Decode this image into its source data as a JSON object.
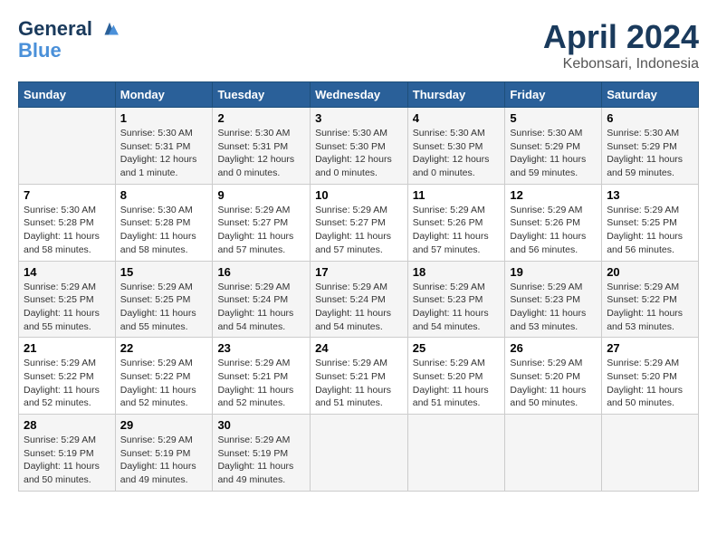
{
  "header": {
    "logo_line1": "General",
    "logo_line2": "Blue",
    "title": "April 2024",
    "subtitle": "Kebonsari, Indonesia"
  },
  "days_of_week": [
    "Sunday",
    "Monday",
    "Tuesday",
    "Wednesday",
    "Thursday",
    "Friday",
    "Saturday"
  ],
  "weeks": [
    [
      {
        "day": "",
        "info": ""
      },
      {
        "day": "1",
        "info": "Sunrise: 5:30 AM\nSunset: 5:31 PM\nDaylight: 12 hours\nand 1 minute."
      },
      {
        "day": "2",
        "info": "Sunrise: 5:30 AM\nSunset: 5:31 PM\nDaylight: 12 hours\nand 0 minutes."
      },
      {
        "day": "3",
        "info": "Sunrise: 5:30 AM\nSunset: 5:30 PM\nDaylight: 12 hours\nand 0 minutes."
      },
      {
        "day": "4",
        "info": "Sunrise: 5:30 AM\nSunset: 5:30 PM\nDaylight: 12 hours\nand 0 minutes."
      },
      {
        "day": "5",
        "info": "Sunrise: 5:30 AM\nSunset: 5:29 PM\nDaylight: 11 hours\nand 59 minutes."
      },
      {
        "day": "6",
        "info": "Sunrise: 5:30 AM\nSunset: 5:29 PM\nDaylight: 11 hours\nand 59 minutes."
      }
    ],
    [
      {
        "day": "7",
        "info": "Sunrise: 5:30 AM\nSunset: 5:28 PM\nDaylight: 11 hours\nand 58 minutes."
      },
      {
        "day": "8",
        "info": "Sunrise: 5:30 AM\nSunset: 5:28 PM\nDaylight: 11 hours\nand 58 minutes."
      },
      {
        "day": "9",
        "info": "Sunrise: 5:29 AM\nSunset: 5:27 PM\nDaylight: 11 hours\nand 57 minutes."
      },
      {
        "day": "10",
        "info": "Sunrise: 5:29 AM\nSunset: 5:27 PM\nDaylight: 11 hours\nand 57 minutes."
      },
      {
        "day": "11",
        "info": "Sunrise: 5:29 AM\nSunset: 5:26 PM\nDaylight: 11 hours\nand 57 minutes."
      },
      {
        "day": "12",
        "info": "Sunrise: 5:29 AM\nSunset: 5:26 PM\nDaylight: 11 hours\nand 56 minutes."
      },
      {
        "day": "13",
        "info": "Sunrise: 5:29 AM\nSunset: 5:25 PM\nDaylight: 11 hours\nand 56 minutes."
      }
    ],
    [
      {
        "day": "14",
        "info": "Sunrise: 5:29 AM\nSunset: 5:25 PM\nDaylight: 11 hours\nand 55 minutes."
      },
      {
        "day": "15",
        "info": "Sunrise: 5:29 AM\nSunset: 5:25 PM\nDaylight: 11 hours\nand 55 minutes."
      },
      {
        "day": "16",
        "info": "Sunrise: 5:29 AM\nSunset: 5:24 PM\nDaylight: 11 hours\nand 54 minutes."
      },
      {
        "day": "17",
        "info": "Sunrise: 5:29 AM\nSunset: 5:24 PM\nDaylight: 11 hours\nand 54 minutes."
      },
      {
        "day": "18",
        "info": "Sunrise: 5:29 AM\nSunset: 5:23 PM\nDaylight: 11 hours\nand 54 minutes."
      },
      {
        "day": "19",
        "info": "Sunrise: 5:29 AM\nSunset: 5:23 PM\nDaylight: 11 hours\nand 53 minutes."
      },
      {
        "day": "20",
        "info": "Sunrise: 5:29 AM\nSunset: 5:22 PM\nDaylight: 11 hours\nand 53 minutes."
      }
    ],
    [
      {
        "day": "21",
        "info": "Sunrise: 5:29 AM\nSunset: 5:22 PM\nDaylight: 11 hours\nand 52 minutes."
      },
      {
        "day": "22",
        "info": "Sunrise: 5:29 AM\nSunset: 5:22 PM\nDaylight: 11 hours\nand 52 minutes."
      },
      {
        "day": "23",
        "info": "Sunrise: 5:29 AM\nSunset: 5:21 PM\nDaylight: 11 hours\nand 52 minutes."
      },
      {
        "day": "24",
        "info": "Sunrise: 5:29 AM\nSunset: 5:21 PM\nDaylight: 11 hours\nand 51 minutes."
      },
      {
        "day": "25",
        "info": "Sunrise: 5:29 AM\nSunset: 5:20 PM\nDaylight: 11 hours\nand 51 minutes."
      },
      {
        "day": "26",
        "info": "Sunrise: 5:29 AM\nSunset: 5:20 PM\nDaylight: 11 hours\nand 50 minutes."
      },
      {
        "day": "27",
        "info": "Sunrise: 5:29 AM\nSunset: 5:20 PM\nDaylight: 11 hours\nand 50 minutes."
      }
    ],
    [
      {
        "day": "28",
        "info": "Sunrise: 5:29 AM\nSunset: 5:19 PM\nDaylight: 11 hours\nand 50 minutes."
      },
      {
        "day": "29",
        "info": "Sunrise: 5:29 AM\nSunset: 5:19 PM\nDaylight: 11 hours\nand 49 minutes."
      },
      {
        "day": "30",
        "info": "Sunrise: 5:29 AM\nSunset: 5:19 PM\nDaylight: 11 hours\nand 49 minutes."
      },
      {
        "day": "",
        "info": ""
      },
      {
        "day": "",
        "info": ""
      },
      {
        "day": "",
        "info": ""
      },
      {
        "day": "",
        "info": ""
      }
    ]
  ]
}
